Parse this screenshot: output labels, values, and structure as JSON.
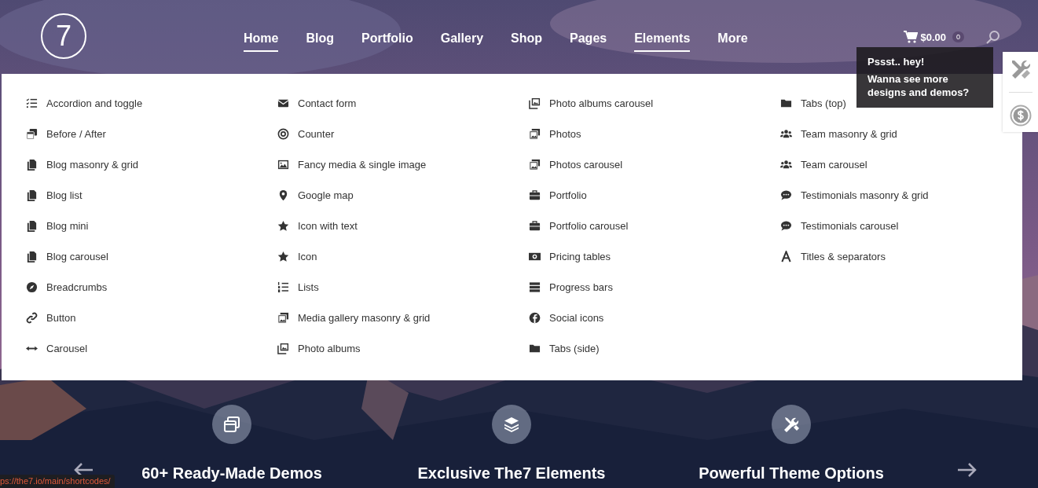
{
  "header": {
    "logo": "7",
    "nav": [
      {
        "label": "Home",
        "active": true
      },
      {
        "label": "Blog",
        "active": false
      },
      {
        "label": "Portfolio",
        "active": false
      },
      {
        "label": "Gallery",
        "active": false
      },
      {
        "label": "Shop",
        "active": false
      },
      {
        "label": "Pages",
        "active": false
      },
      {
        "label": "Elements",
        "active": true
      },
      {
        "label": "More",
        "active": false
      }
    ],
    "cart": {
      "total": "$0.00",
      "count": "0"
    }
  },
  "menu": {
    "columns": [
      {
        "items": [
          {
            "label": "Accordion and toggle"
          },
          {
            "label": "Before / After"
          },
          {
            "label": "Blog masonry & grid"
          },
          {
            "label": "Blog list"
          },
          {
            "label": "Blog mini"
          },
          {
            "label": "Blog carousel"
          },
          {
            "label": "Breadcrumbs"
          },
          {
            "label": "Button"
          },
          {
            "label": "Carousel"
          }
        ]
      },
      {
        "items": [
          {
            "label": "Contact form"
          },
          {
            "label": "Counter"
          },
          {
            "label": "Fancy media & single image"
          },
          {
            "label": "Google map"
          },
          {
            "label": "Icon with text"
          },
          {
            "label": "Icon"
          },
          {
            "label": "Lists"
          },
          {
            "label": "Media gallery masonry & grid"
          },
          {
            "label": "Photo albums"
          }
        ]
      },
      {
        "items": [
          {
            "label": "Photo albums carousel"
          },
          {
            "label": "Photos"
          },
          {
            "label": "Photos carousel"
          },
          {
            "label": "Portfolio"
          },
          {
            "label": "Portfolio carousel"
          },
          {
            "label": "Pricing tables"
          },
          {
            "label": "Progress bars"
          },
          {
            "label": "Social icons"
          },
          {
            "label": "Tabs (side)"
          }
        ]
      },
      {
        "items": [
          {
            "label": "Tabs (top)"
          },
          {
            "label": "Team masonry & grid"
          },
          {
            "label": "Team carousel"
          },
          {
            "label": "Testimonials masonry & grid"
          },
          {
            "label": "Testimonials carousel"
          },
          {
            "label": "Titles & separators"
          }
        ]
      }
    ]
  },
  "tooltip": {
    "title": "Pssst.. hey!",
    "text": "Wanna see more designs and demos?"
  },
  "features": [
    {
      "title": "60+ Ready-Made Demos"
    },
    {
      "title": "Exclusive The7 Elements"
    },
    {
      "title": "Powerful Theme Options"
    }
  ],
  "status_link": "ps://the7.io/main/shortcodes/"
}
